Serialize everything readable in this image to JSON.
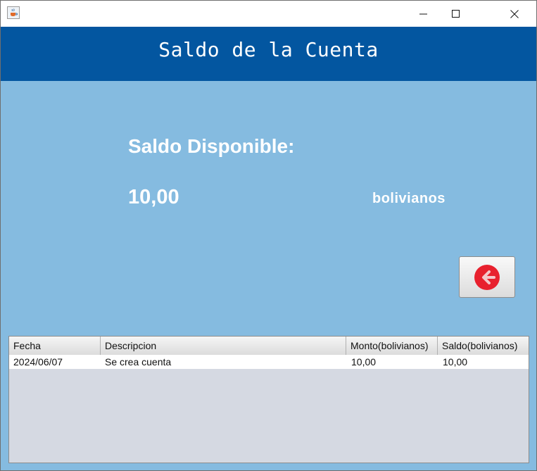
{
  "window": {
    "icon": "java-cup-icon",
    "controls": [
      "minimize-icon",
      "maximize-icon",
      "close-icon"
    ]
  },
  "header": {
    "title": "Saldo de la Cuenta",
    "background": "#0356a0"
  },
  "balance": {
    "label": "Saldo Disponible:",
    "amount": "10,00",
    "currency": "bolivianos"
  },
  "back_button": {
    "icon": "arrow-left-icon",
    "color": "#e8212e"
  },
  "table": {
    "columns": [
      "Fecha",
      "Descripcion",
      "Monto(bolivianos)",
      "Saldo(bolivianos)"
    ],
    "rows": [
      [
        "2024/06/07",
        "Se crea cuenta",
        "10,00",
        "10,00"
      ]
    ]
  },
  "colors": {
    "panel_background": "#85bbe0",
    "table_empty_area": "#d5d9e2"
  }
}
